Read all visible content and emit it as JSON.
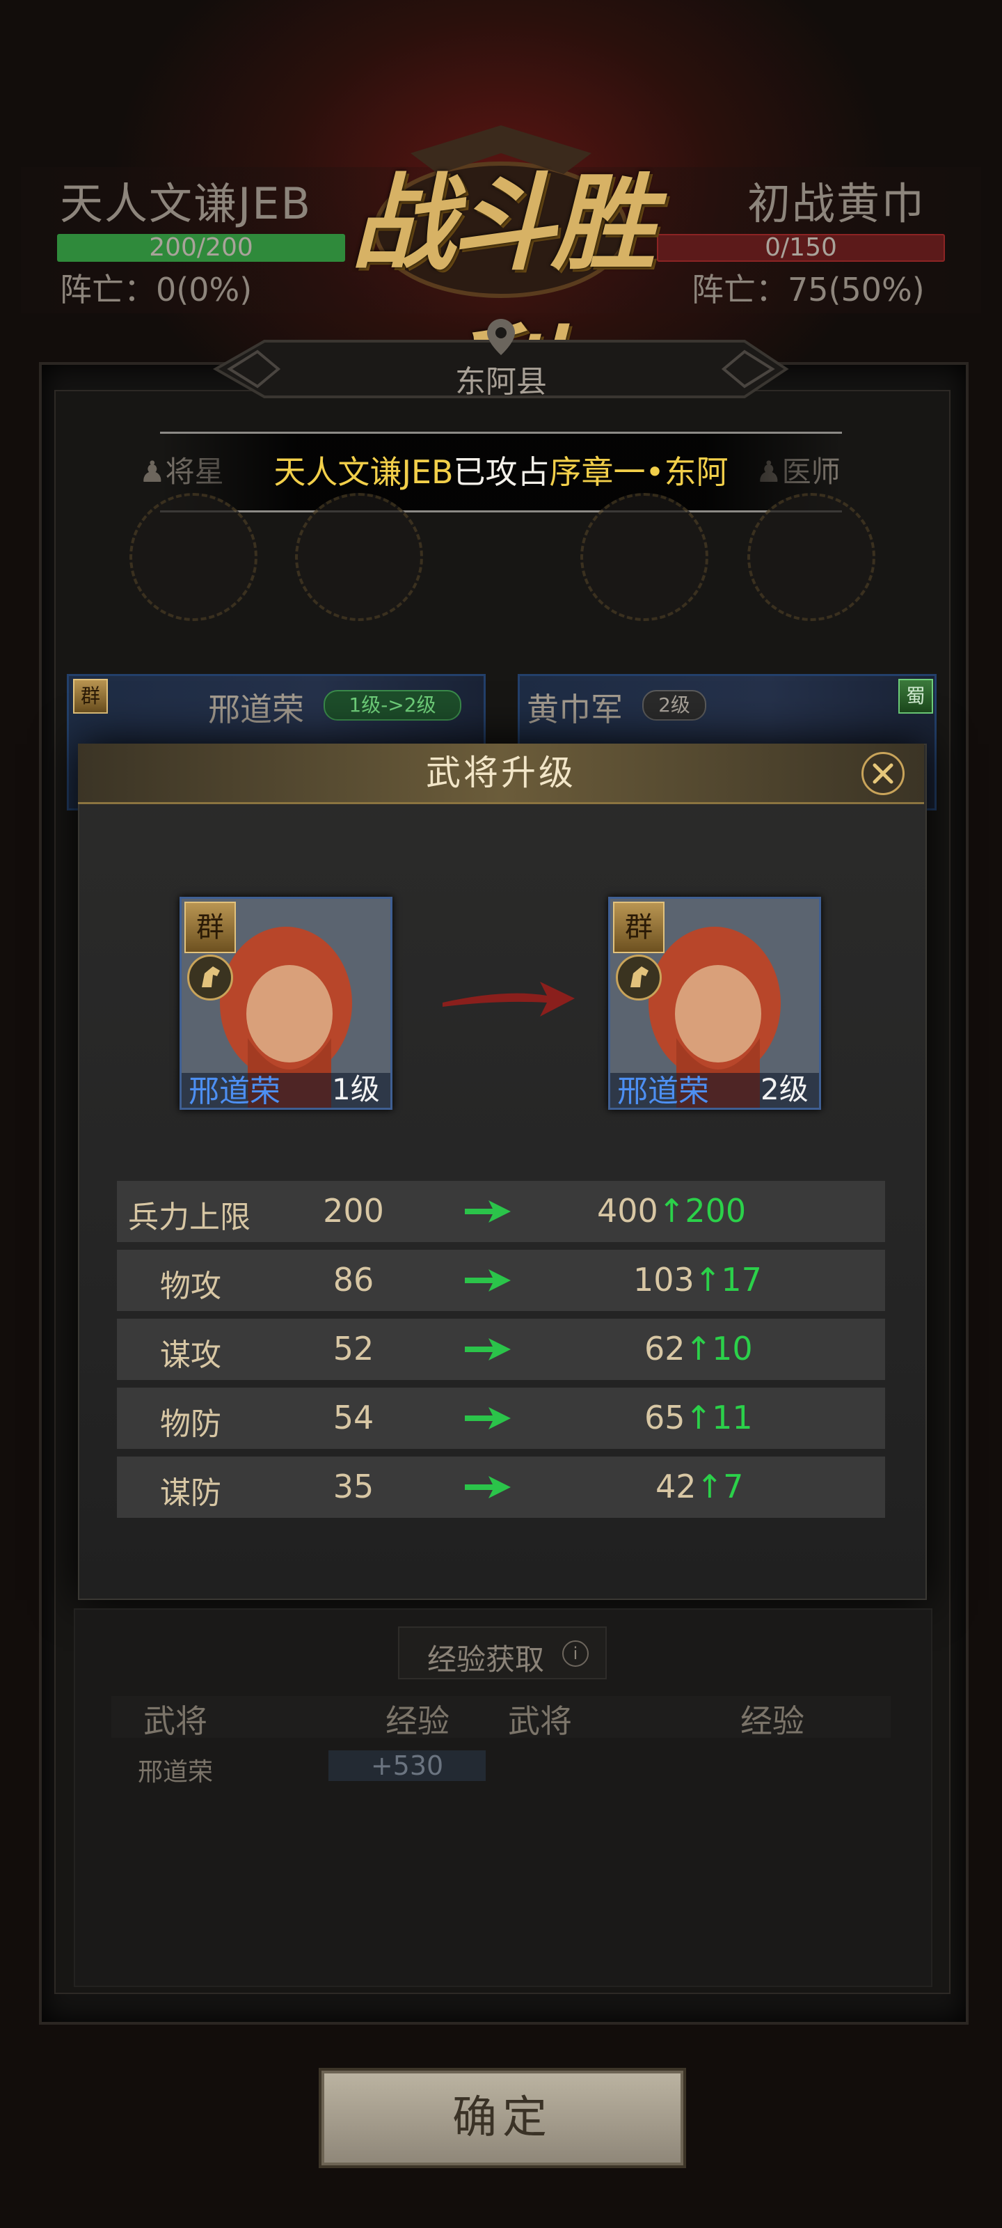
{
  "battle": {
    "victory_text": "战斗胜利",
    "left_side": {
      "name": "天人文谦JEB",
      "troops": "200/200",
      "troops_fill": 1.0,
      "dead": "阵亡：0(0%)"
    },
    "right_side": {
      "name": "初战黄巾",
      "troops": "0/150",
      "troops_fill": 0.0,
      "dead": "阵亡：75(50%)"
    },
    "location": "东阿县"
  },
  "announcement": {
    "prefix": "天人文谦JEB",
    "middle": "已攻占",
    "target": "序章一•东阿"
  },
  "roles": [
    "将星",
    "医师"
  ],
  "cards": [
    {
      "faction": "群",
      "name": "邢道荣",
      "level_badge": "1级->2级"
    },
    {
      "faction": "蜀",
      "name": "黄巾军",
      "level_badge": "2级"
    }
  ],
  "modal": {
    "title": "武将升级",
    "before": {
      "faction": "群",
      "name": "邢道荣",
      "level": "1级"
    },
    "after": {
      "faction": "群",
      "name": "邢道荣",
      "level": "2级"
    },
    "stats": [
      {
        "name": "兵力上限",
        "old": "200",
        "new": "400",
        "inc": "200"
      },
      {
        "name": "物攻",
        "old": "86",
        "new": "103",
        "inc": "17"
      },
      {
        "name": "谋攻",
        "old": "52",
        "new": "62",
        "inc": "10"
      },
      {
        "name": "物防",
        "old": "54",
        "new": "65",
        "inc": "11"
      },
      {
        "name": "谋防",
        "old": "35",
        "new": "42",
        "inc": "7"
      }
    ],
    "inc_arrow": "↑"
  },
  "experience": {
    "title": "经验获取",
    "columns": [
      "武将",
      "经验",
      "武将",
      "经验"
    ],
    "rows": [
      {
        "general": "邢道荣",
        "exp": "+530"
      }
    ]
  },
  "confirm_label": "确定",
  "colors": {
    "gold": "#d7b265",
    "green": "#2bd14a",
    "blue_name": "#4d8ff2",
    "hp_green": "#2f8a3b",
    "hp_red": "#8c2424"
  }
}
